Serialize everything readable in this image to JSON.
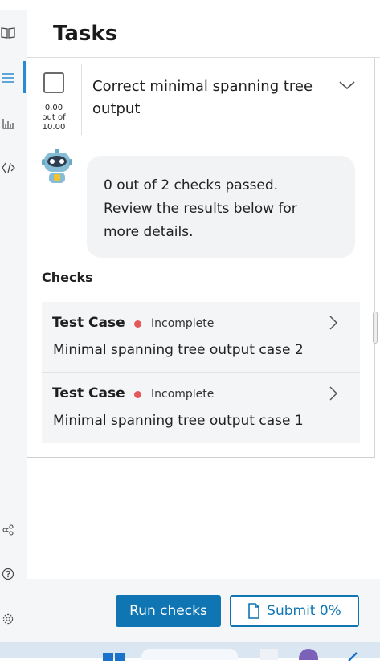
{
  "header": {
    "title": "Tasks"
  },
  "rail": {
    "icons": [
      "book-icon",
      "list-icon",
      "chart-icon",
      "code-icon",
      "share-icon",
      "help-icon",
      "settings-icon"
    ]
  },
  "task": {
    "title": "Correct minimal spanning tree output",
    "score_value": "0.00",
    "score_out_of": "out of",
    "score_max": "10.00"
  },
  "assistant": {
    "message_line1": "0 out of 2 checks passed.",
    "message_line2": "Review the results below for",
    "message_line3": "more details."
  },
  "checks": {
    "label": "Checks",
    "items": [
      {
        "type": "Test Case",
        "status": "Incomplete",
        "name": "Minimal spanning tree output case 2"
      },
      {
        "type": "Test Case",
        "status": "Incomplete",
        "name": "Minimal spanning tree output case 1"
      }
    ]
  },
  "footer": {
    "run_label": "Run checks",
    "submit_label": "Submit 0%"
  },
  "colors": {
    "accent": "#0f75b3",
    "status_incomplete": "#e45a5a",
    "rail_active": "#2a8bd0"
  }
}
